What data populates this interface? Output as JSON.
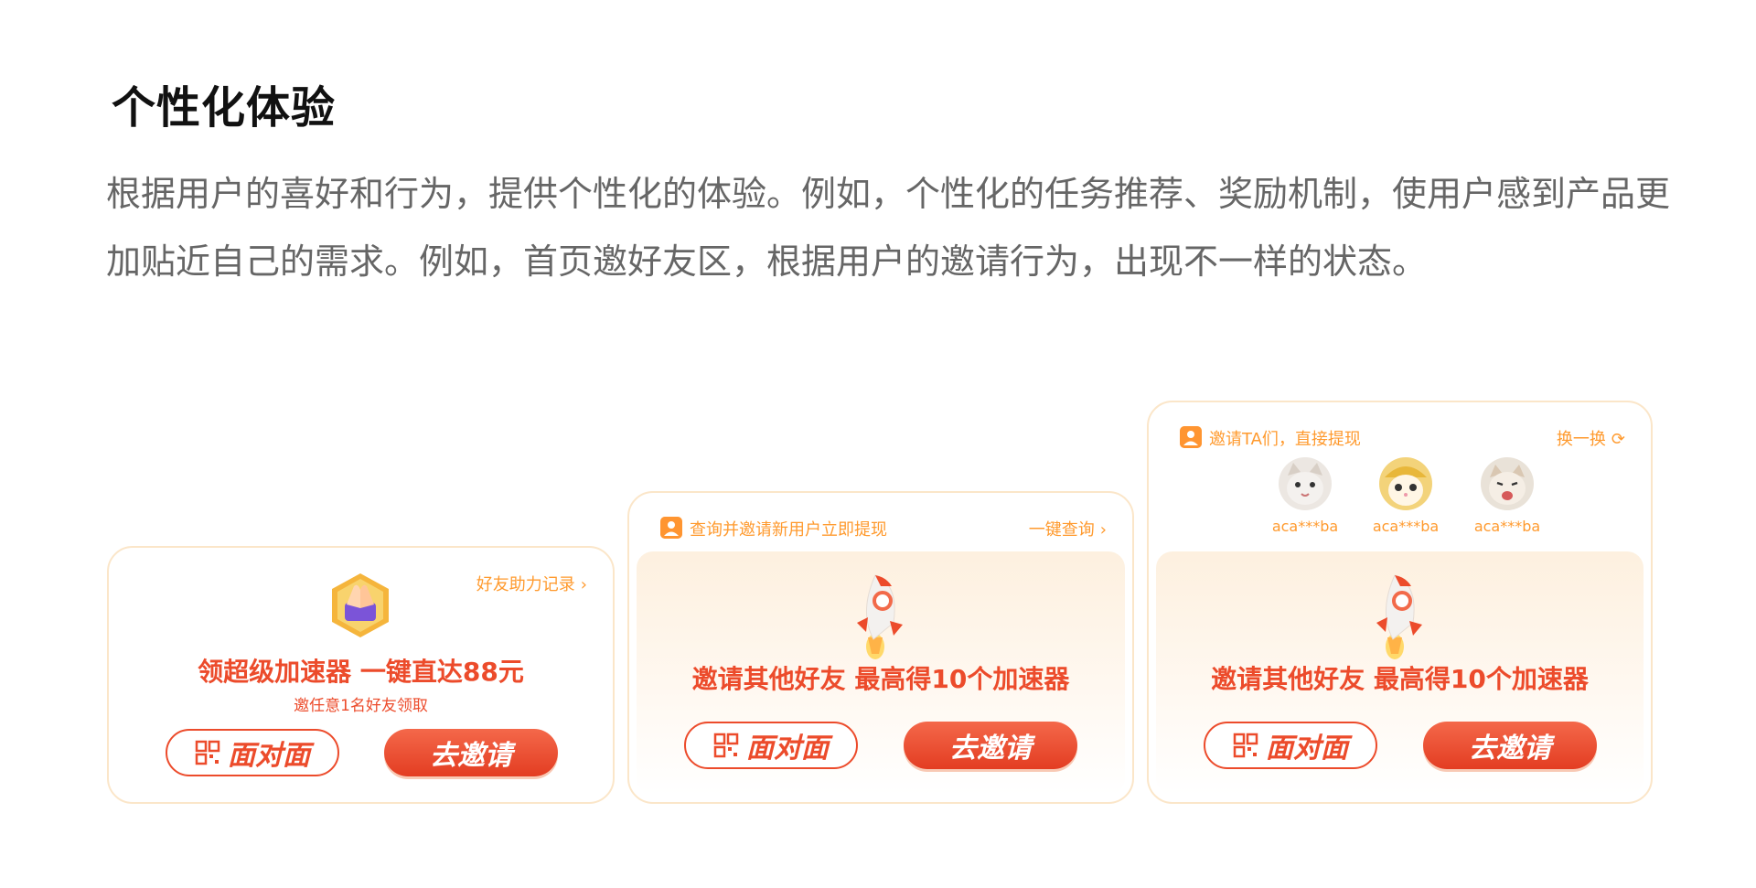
{
  "section": {
    "title": "个性化体验",
    "description": "根据用户的喜好和行为，提供个性化的体验。例如，个性化的任务推荐、奖励机制，使用户感到产品更加贴近自己的需求。例如，首页邀好友区，根据用户的邀请行为，出现不一样的状态。"
  },
  "card1": {
    "record_link": "好友助力记录",
    "headline": "领超级加速器 一键直达88元",
    "subline": "邀任意1名好友领取",
    "face_button": "面对面",
    "invite_button": "去邀请"
  },
  "card2": {
    "header_text": "查询并邀请新用户立即提现",
    "header_link": "一键查询",
    "headline": "邀请其他好友 最高得10个加速器",
    "face_button": "面对面",
    "invite_button": "去邀请"
  },
  "card3": {
    "header_text": "邀请TA们，直接提现",
    "header_link": "换一换",
    "friends": [
      {
        "name": "aca***ba"
      },
      {
        "name": "aca***ba"
      },
      {
        "name": "aca***ba"
      }
    ],
    "headline": "邀请其他好友 最高得10个加速器",
    "face_button": "面对面",
    "invite_button": "去邀请"
  },
  "icons": {
    "chevron": "chevron-right-icon",
    "refresh": "refresh-icon",
    "person": "person-icon",
    "qr": "qr-code-icon",
    "rocket": "rocket-icon",
    "badge": "handshake-badge-icon"
  },
  "colors": {
    "accent_red": "#ec4b2b",
    "accent_orange": "#ff9a2e",
    "card_border": "#fbe6c9"
  }
}
